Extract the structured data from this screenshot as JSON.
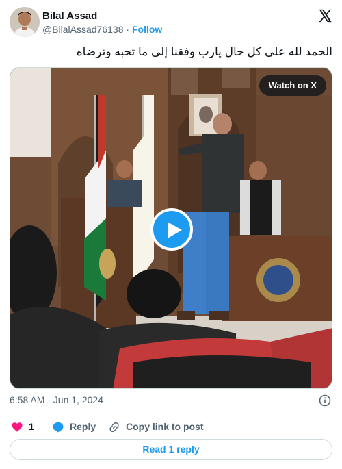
{
  "author": {
    "name": "Bilal Assad",
    "handle": "@BilalAssad76138",
    "separator": "·",
    "follow_label": "Follow"
  },
  "tweet": {
    "text": "الحمد لله على كل حال يارب وفقنا إلى ما تحبه وترضاه"
  },
  "media": {
    "watch_label": "Watch on X",
    "play_icon": "play-icon"
  },
  "meta": {
    "timestamp": "6:58 AM · Jun 1, 2024"
  },
  "actions": {
    "like_count": "1",
    "reply_label": "Reply",
    "copy_label": "Copy link to post"
  },
  "footer": {
    "read_replies_label": "Read 1 reply"
  },
  "colors": {
    "accent": "#1d9bf0",
    "like": "#f91880",
    "muted": "#536471",
    "text": "#0f1419",
    "border": "#cfd9de"
  }
}
